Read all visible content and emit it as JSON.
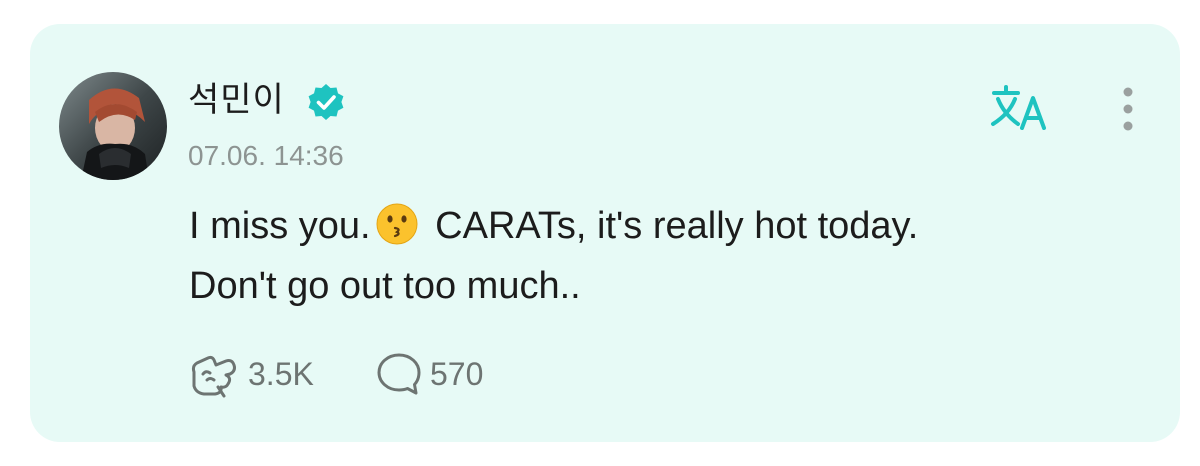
{
  "post": {
    "author": {
      "name": "석민이",
      "verified": true,
      "avatar": "avatar-photo"
    },
    "timestamp": "07.06. 14:36",
    "body_lines": [
      {
        "before_emoji": "I miss you.",
        "emoji": "kissing-face-icon",
        "after_emoji": "CARATs, it's really hot today."
      },
      {
        "text": "Don't go out too much.."
      }
    ],
    "stats": {
      "likes": "3.5K",
      "comments": "570"
    },
    "actions": {
      "translate_icon": "translate-icon",
      "more_icon": "more-vertical-icon"
    }
  },
  "colors": {
    "card_background": "#e7faf6",
    "accent": "#1ec3c0",
    "text": "#1c1c1c",
    "muted": "#8d9492"
  }
}
